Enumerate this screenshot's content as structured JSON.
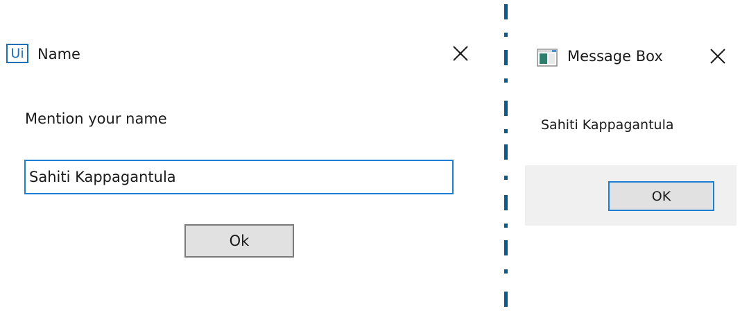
{
  "name_dialog": {
    "logo_text": "Ui",
    "title": "Name",
    "prompt": "Mention your name",
    "input_value": "Sahiti Kappagantula",
    "ok_label": "Ok",
    "icons": {
      "logo": "uipath-logo-icon",
      "close": "close-icon"
    },
    "colors": {
      "accent": "#1e7ed4",
      "logo": "#1f6fb7",
      "button_face": "#e1e1e1"
    }
  },
  "message_box": {
    "title": "Message Box",
    "message": "Sahiti Kappagantula",
    "ok_label": "OK",
    "icons": {
      "app": "window-app-icon",
      "close": "close-icon"
    },
    "colors": {
      "footer": "#f0f0f0",
      "accent": "#1e7ed4"
    }
  },
  "separator": {
    "color": "#0b5a8a",
    "style": "dash-dot"
  }
}
